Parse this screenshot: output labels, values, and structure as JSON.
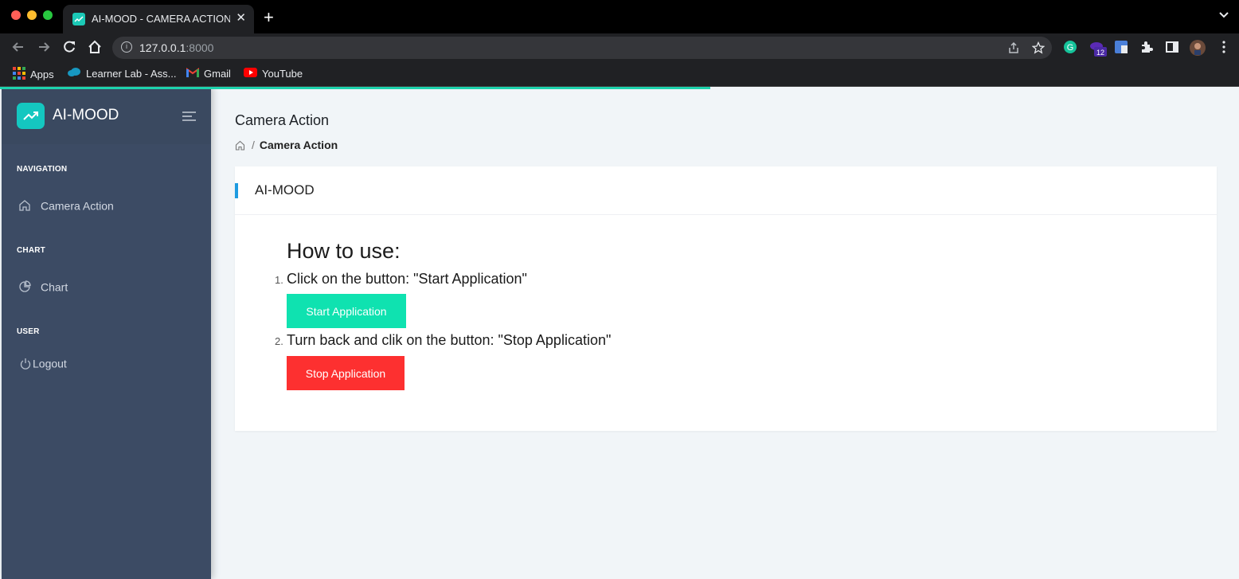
{
  "browser": {
    "tab_title": "AI-MOOD - CAMERA ACTION |",
    "tab_close": "✕",
    "new_tab": "+",
    "url_host": "127.0.0.1",
    "url_port": ":8000",
    "extension_badge": "12",
    "bookmarks": [
      {
        "label": "Apps",
        "icon": "apps-grid-icon"
      },
      {
        "label": "Learner Lab - Ass...",
        "icon": "salesforce-cloud-icon"
      },
      {
        "label": "Gmail",
        "icon": "gmail-icon"
      },
      {
        "label": "YouTube",
        "icon": "youtube-icon"
      }
    ]
  },
  "page_load_progress": 0.573,
  "sidebar": {
    "brand": "AI-MOOD",
    "sections": [
      {
        "title": "NAVIGATION",
        "items": [
          {
            "label": "Camera Action",
            "icon": "home-icon"
          }
        ]
      },
      {
        "title": "CHART",
        "items": [
          {
            "label": "Chart",
            "icon": "pie-chart-icon"
          }
        ]
      },
      {
        "title": "USER",
        "items": [
          {
            "label": "Logout",
            "icon": "power-icon"
          }
        ]
      }
    ]
  },
  "main": {
    "page_title": "Camera Action",
    "breadcrumb": {
      "separator": "/",
      "current": "Camera Action"
    },
    "card": {
      "title": "AI-MOOD",
      "heading": "How to use:",
      "steps": [
        {
          "num": "1.",
          "text": "Click on the button: \"Start Application\"",
          "button": "Start Application"
        },
        {
          "num": "2.",
          "text": "Turn back and clik on the button: \"Stop Application\"",
          "button": "Stop Application"
        }
      ]
    }
  },
  "colors": {
    "sidebar_bg": "#3c4b64",
    "accent_teal": "#14c7c0",
    "start_button": "#0fe2b0",
    "stop_button": "#fd3030",
    "card_accent": "#1e9be0",
    "content_bg": "#f1f5f8"
  }
}
